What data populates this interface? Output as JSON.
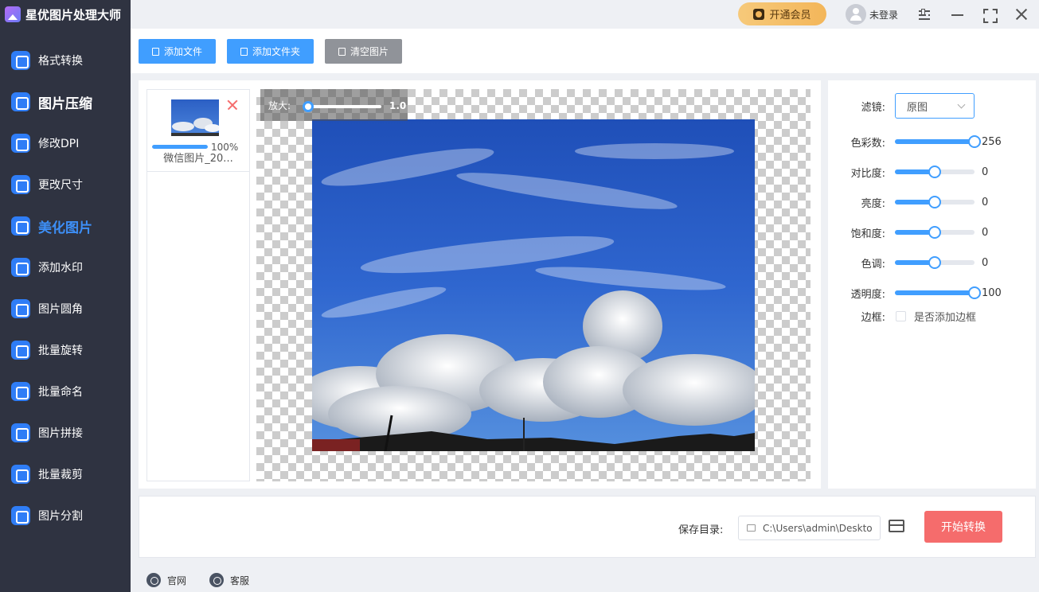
{
  "app": {
    "title": "星优图片处理大师"
  },
  "header": {
    "vip_label": "开通会员",
    "user_label": "未登录"
  },
  "sidebar": {
    "items": [
      {
        "label": "格式转换",
        "icon": "format-convert-icon"
      },
      {
        "label": "图片压缩",
        "icon": "compress-icon"
      },
      {
        "label": "修改DPI",
        "icon": "dpi-icon"
      },
      {
        "label": "更改尺寸",
        "icon": "resize-icon"
      },
      {
        "label": "美化图片",
        "icon": "beautify-icon",
        "active": true
      },
      {
        "label": "添加水印",
        "icon": "watermark-icon"
      },
      {
        "label": "图片圆角",
        "icon": "round-corner-icon"
      },
      {
        "label": "批量旋转",
        "icon": "rotate-icon"
      },
      {
        "label": "批量命名",
        "icon": "rename-icon"
      },
      {
        "label": "图片拼接",
        "icon": "stitch-icon"
      },
      {
        "label": "批量裁剪",
        "icon": "crop-icon"
      },
      {
        "label": "图片分割",
        "icon": "split-icon"
      }
    ]
  },
  "toolbar": {
    "add_file": "添加文件",
    "add_folder": "添加文件夹",
    "clear": "清空图片"
  },
  "file_list": {
    "progress_text": "100%",
    "progress_value": 1.0,
    "filename": "微信图片_20..."
  },
  "preview": {
    "zoom_label": "放大:",
    "zoom_value": "1.0"
  },
  "settings": {
    "filter_label": "滤镜:",
    "filter_value": "原图",
    "sliders": [
      {
        "label": "色彩数:",
        "value": "256",
        "fraction": 1.0
      },
      {
        "label": "对比度:",
        "value": "0",
        "fraction": 0.5
      },
      {
        "label": "亮度:",
        "value": "0",
        "fraction": 0.5
      },
      {
        "label": "饱和度:",
        "value": "0",
        "fraction": 0.5
      },
      {
        "label": "色调:",
        "value": "0",
        "fraction": 0.5
      },
      {
        "label": "透明度:",
        "value": "100",
        "fraction": 1.0
      }
    ],
    "border_label": "边框:",
    "border_checkbox_label": "是否添加边框"
  },
  "bottom": {
    "save_label": "保存目录:",
    "save_path": "C:\\Users\\admin\\Deskto",
    "start_button": "开始转换"
  },
  "footer": {
    "website": "官网",
    "support": "客服"
  },
  "colors": {
    "accent": "#409eff",
    "sidebar_bg": "#2f3341",
    "start": "#f56c6c",
    "vip": "#f3b65a"
  }
}
